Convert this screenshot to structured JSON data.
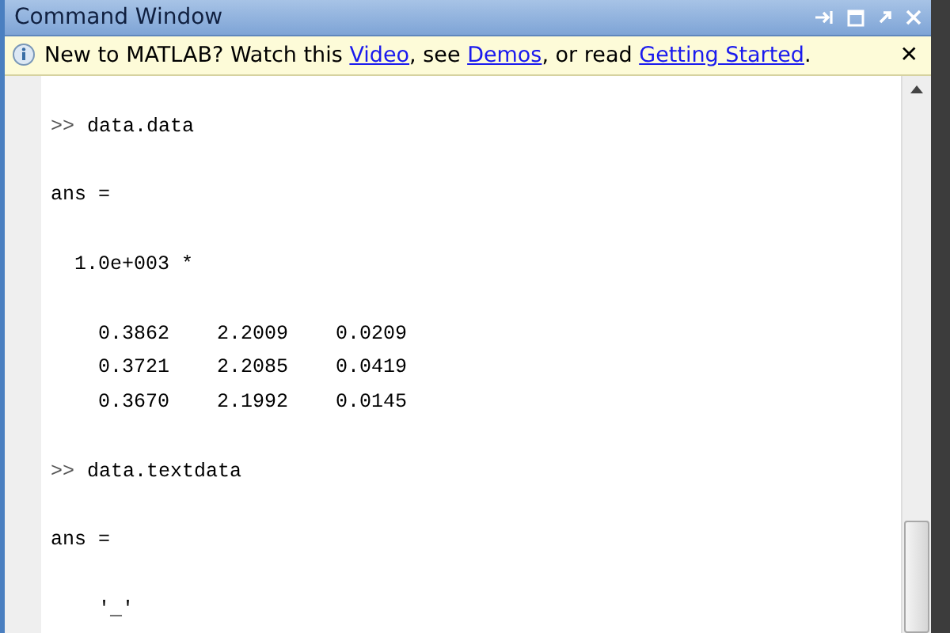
{
  "window": {
    "title": "Command Window"
  },
  "info_bar": {
    "parts": [
      {
        "kind": "text",
        "text": "New to MATLAB? Watch this "
      },
      {
        "kind": "link",
        "text": "Video"
      },
      {
        "kind": "text",
        "text": ", see "
      },
      {
        "kind": "link",
        "text": "Demos"
      },
      {
        "kind": "text",
        "text": ", or read "
      },
      {
        "kind": "link",
        "text": "Getting Started"
      },
      {
        "kind": "text",
        "text": "."
      }
    ],
    "close": "✕"
  },
  "lines": [
    {
      "kind": "blank"
    },
    {
      "kind": "prompt",
      "prompt": ">>",
      "text": "data.data"
    },
    {
      "kind": "blank"
    },
    {
      "kind": "output",
      "text": "ans ="
    },
    {
      "kind": "blank"
    },
    {
      "kind": "output",
      "text": "  1.0e+003 *"
    },
    {
      "kind": "blank"
    },
    {
      "kind": "output",
      "text": "    0.3862    2.2009    0.0209"
    },
    {
      "kind": "output",
      "text": "    0.3721    2.2085    0.0419"
    },
    {
      "kind": "output",
      "text": "    0.3670    2.1992    0.0145"
    },
    {
      "kind": "blank"
    },
    {
      "kind": "prompt",
      "prompt": ">>",
      "text": "data.textdata"
    },
    {
      "kind": "blank"
    },
    {
      "kind": "output",
      "text": "ans ="
    },
    {
      "kind": "blank"
    },
    {
      "kind": "output",
      "text": "    '_'"
    }
  ]
}
